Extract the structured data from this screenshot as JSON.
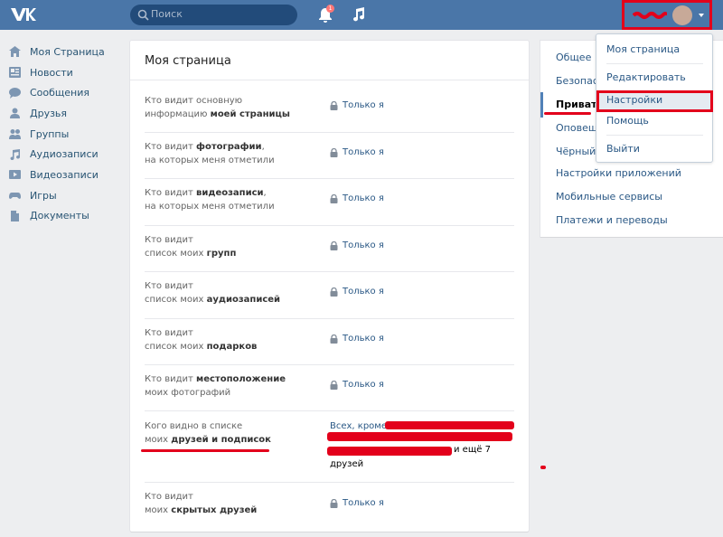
{
  "header": {
    "search_placeholder": "Поиск",
    "notification_count": "1",
    "icons": [
      "vk-logo-icon",
      "search-icon",
      "bell-icon",
      "music-icon",
      "avatar",
      "caret-down-icon"
    ]
  },
  "leftnav": {
    "items": [
      {
        "label": "Моя Страница",
        "icon": "home-icon"
      },
      {
        "label": "Новости",
        "icon": "news-icon"
      },
      {
        "label": "Сообщения",
        "icon": "message-icon"
      },
      {
        "label": "Друзья",
        "icon": "friends-icon"
      },
      {
        "label": "Группы",
        "icon": "groups-icon"
      },
      {
        "label": "Аудиозаписи",
        "icon": "audio-icon"
      },
      {
        "label": "Видеозаписи",
        "icon": "video-icon"
      },
      {
        "label": "Игры",
        "icon": "gamepad-icon"
      },
      {
        "label": "Документы",
        "icon": "document-icon"
      }
    ]
  },
  "main": {
    "title": "Моя страница",
    "rows": [
      {
        "line1a": "Кто видит основную",
        "line2a": "информацию ",
        "line2b": "моей страницы",
        "value": "Только я"
      },
      {
        "line1a": "Кто видит ",
        "line1b": "фотографии",
        "line1c": ",",
        "line2a": "на которых меня отметили",
        "value": "Только я"
      },
      {
        "line1a": "Кто видит ",
        "line1b": "видеозаписи",
        "line1c": ",",
        "line2a": "на которых меня отметили",
        "value": "Только я"
      },
      {
        "line1a": "Кто видит",
        "line2a": "список моих ",
        "line2b": "групп",
        "value": "Только я"
      },
      {
        "line1a": "Кто видит",
        "line2a": "список моих ",
        "line2b": "аудиозаписей",
        "value": "Только я"
      },
      {
        "line1a": "Кто видит",
        "line2a": "список моих ",
        "line2b": "подарков",
        "value": "Только я"
      },
      {
        "line1a": "Кто видит ",
        "line1b": "местоположение",
        "line2a": "моих фотографий",
        "value": "Только я"
      },
      {
        "line1a": "Кого видно в списке",
        "line2a": "моих ",
        "line2b": "друзей и подписок",
        "value_prefix": "Всех, кроме:",
        "value_suffix": "и ещё 7",
        "value_line3": "друзей"
      },
      {
        "line1a": "Кто видит",
        "line2a": "моих ",
        "line2b": "скрытых друзей",
        "value": "Только я"
      }
    ]
  },
  "right_menu": {
    "items": [
      "Общее",
      "Безопасность",
      "Приватность",
      "Оповещения",
      "Чёрный список",
      "Настройки приложений",
      "Мобильные сервисы",
      "Платежи и переводы"
    ],
    "visible": [
      "Общее",
      "Безопасн",
      "Приватн",
      "Оповещ",
      "Чёрный с",
      "Настройки приложений",
      "Мобильные сервисы",
      "Платежи и переводы"
    ],
    "active_index": 2
  },
  "dropdown": {
    "items": [
      "Моя страница",
      "Редактировать",
      "Настройки",
      "Помощь",
      "Выйти"
    ],
    "highlighted": "Настройки"
  },
  "colors": {
    "header_bg": "#4a76a8",
    "link": "#2a5885",
    "annotation_red": "#e3001b"
  }
}
